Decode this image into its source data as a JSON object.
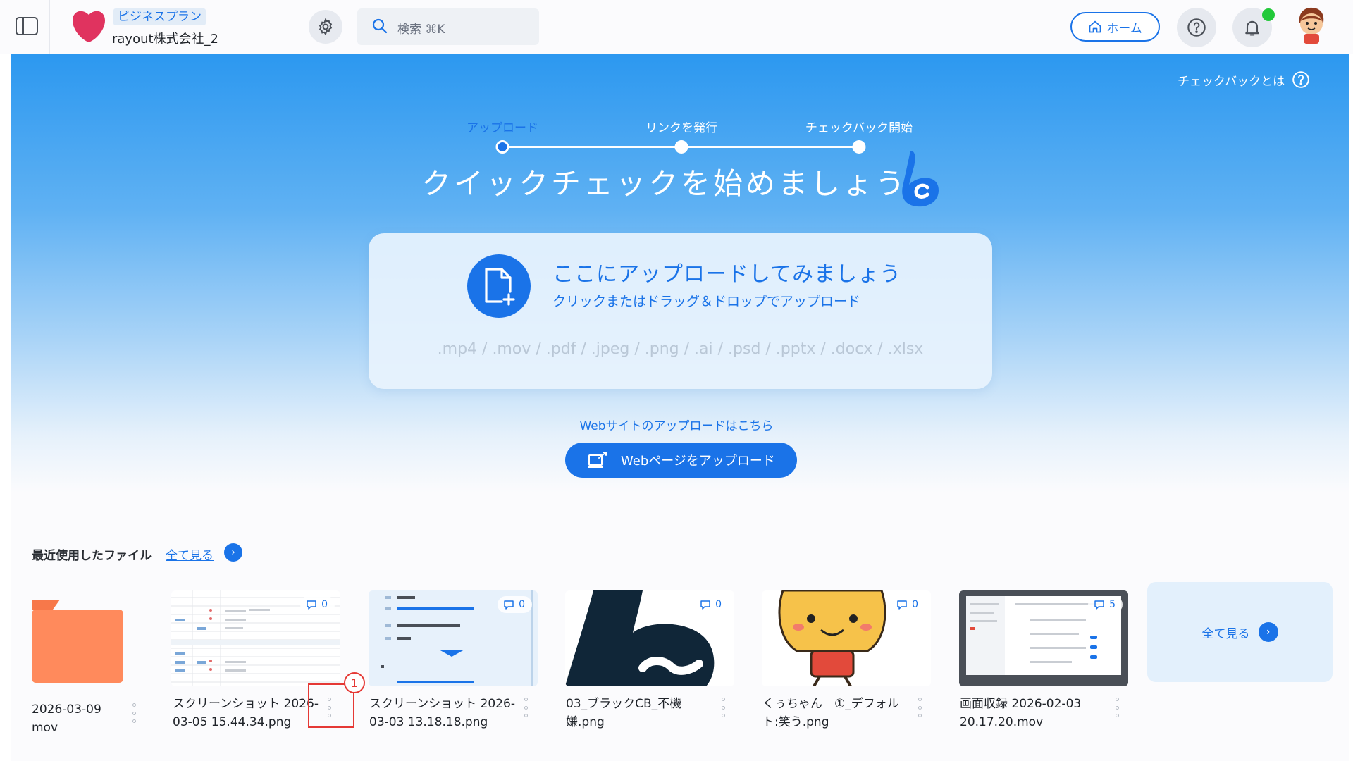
{
  "header": {
    "plan": "ビジネスプラン",
    "org_name": "rayout株式会社_2",
    "search_placeholder": "検索 ⌘K",
    "home_label": "ホーム"
  },
  "hero": {
    "whats_checkback": "チェックバックとは",
    "steps": [
      {
        "label": "アップロード",
        "active": true
      },
      {
        "label": "リンクを発行",
        "active": false
      },
      {
        "label": "チェックバック開始",
        "active": false
      }
    ],
    "title": "クイックチェックを始めましょう"
  },
  "upload": {
    "title": "ここにアップロードしてみましょう",
    "subtitle": "クリックまたはドラッグ＆ドロップでアップロード",
    "formats": ".mp4 / .mov / .pdf / .jpeg / .png / .ai / .psd / .pptx / .docx / .xlsx"
  },
  "web_upload": {
    "link": "Webサイトのアップロードはこちら",
    "button": "Webページをアップロード"
  },
  "recent": {
    "title": "最近使用したファイル",
    "see_all": "全て見る",
    "files": [
      {
        "name_line1": "2026-03-09",
        "name_line2": "mov",
        "type": "folder"
      },
      {
        "name_line1": "スクリーンショット 2026-",
        "name_line2": "03-05 15.44.34.png",
        "comments": "0",
        "type": "table"
      },
      {
        "name_line1": "スクリーンショット 2026-",
        "name_line2": "03-03 13.18.18.png",
        "comments": "0",
        "type": "list"
      },
      {
        "name_line1": "03_ブラックCB_不機",
        "name_line2": "嫌.png",
        "comments": "0",
        "type": "logo"
      },
      {
        "name_line1": "くぅちゃん　①_デフォル",
        "name_line2": "ト:笑う.png",
        "comments": "0",
        "type": "character"
      },
      {
        "name_line1": "画面収録 2026-02-03",
        "name_line2": "20.17.20.mov",
        "comments": "5",
        "type": "video"
      }
    ],
    "see_all_tile": "全て見る"
  },
  "annotation": {
    "marker": "1"
  },
  "colors": {
    "accent": "#1a73e8",
    "folder": "#ff8a5c",
    "notify": "#22c93a",
    "highlight": "#e53935"
  }
}
